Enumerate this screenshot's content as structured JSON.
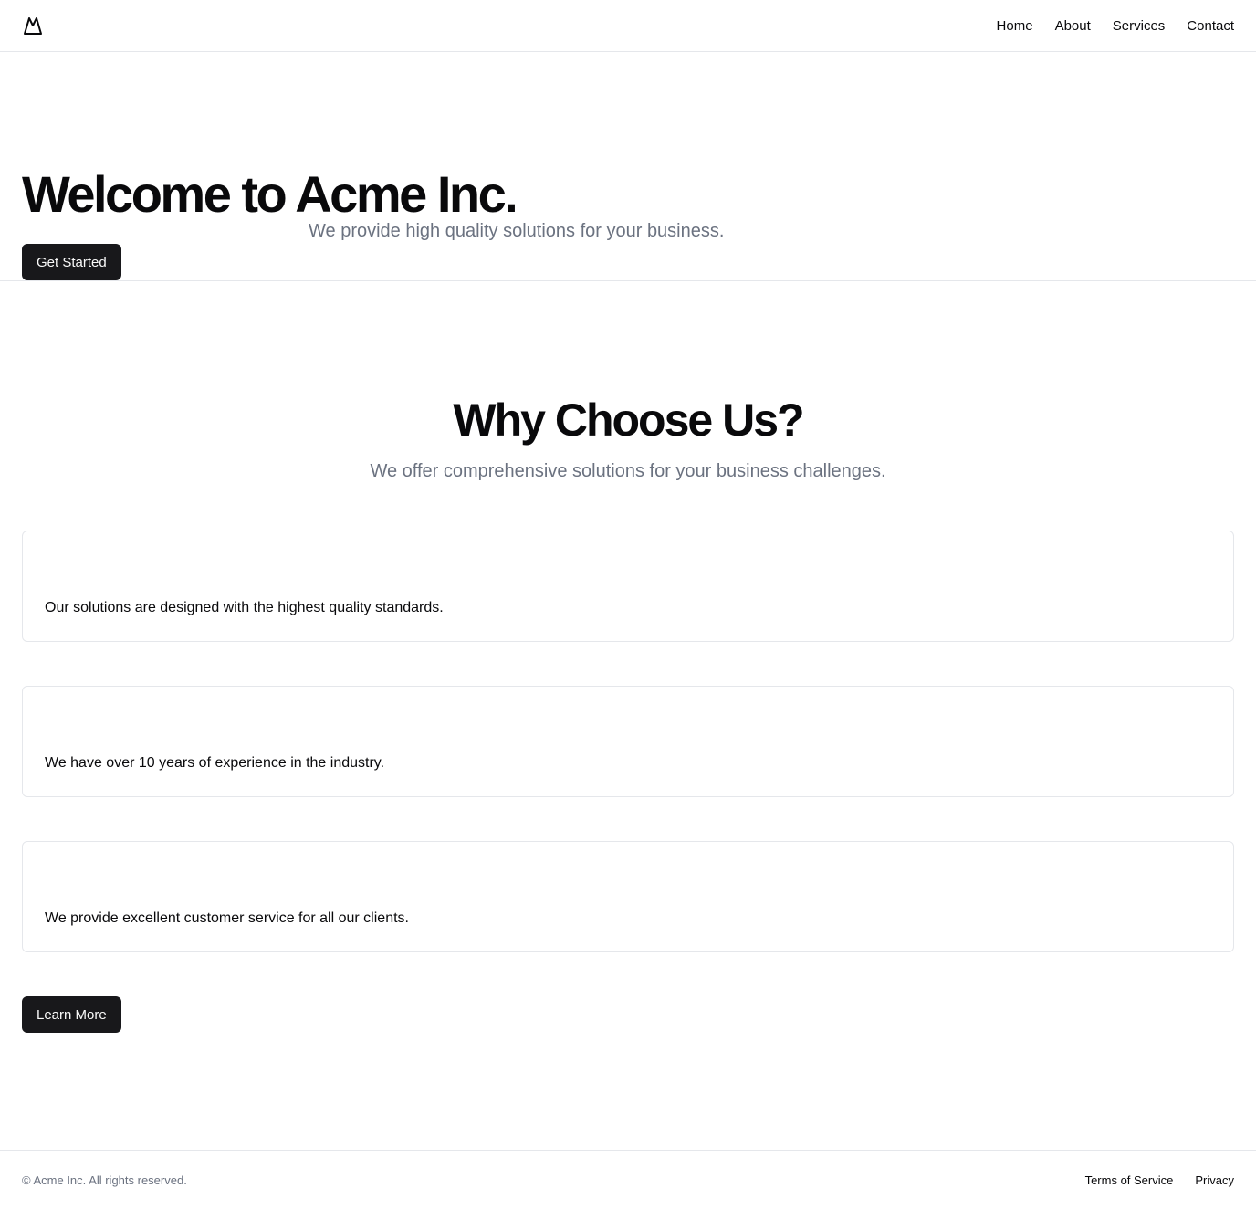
{
  "header": {
    "logo_icon": "mountain-icon",
    "nav": [
      {
        "label": "Home"
      },
      {
        "label": "About"
      },
      {
        "label": "Services"
      },
      {
        "label": "Contact"
      }
    ]
  },
  "hero": {
    "title": "Welcome to Acme Inc.",
    "subtitle": "We provide high quality solutions for your business.",
    "cta_label": "Get Started"
  },
  "why": {
    "title": "Why Choose Us?",
    "subtitle": "We offer comprehensive solutions for your business challenges.",
    "cards": [
      {
        "text": "Our solutions are designed with the highest quality standards."
      },
      {
        "text": "We have over 10 years of experience in the industry."
      },
      {
        "text": "We provide excellent customer service for all our clients."
      }
    ],
    "cta_label": "Learn More"
  },
  "footer": {
    "copyright": "© Acme Inc. All rights reserved.",
    "links": [
      {
        "label": "Terms of Service"
      },
      {
        "label": "Privacy"
      }
    ]
  },
  "colors": {
    "primary": "#18181b",
    "muted_text": "#6b7280",
    "border": "#e5e7eb"
  }
}
